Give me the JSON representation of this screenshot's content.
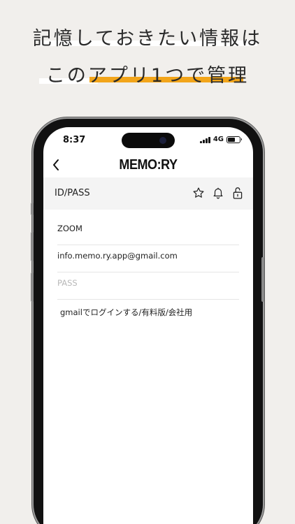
{
  "headline": {
    "line1": "記憶しておきたい情報は",
    "line2": "このアプリ1つで管理",
    "accent_color": "#f2a51a"
  },
  "status_bar": {
    "time": "8:37",
    "network": "4G"
  },
  "nav": {
    "back_icon": "chevron-left-icon",
    "logo": "MEMO:RY"
  },
  "toolbar": {
    "title": "ID/PASS",
    "icons": [
      "star-icon",
      "bell-icon",
      "unlock-icon"
    ]
  },
  "form": {
    "service": "ZOOM",
    "id": "info.memo.ry.app@gmail.com",
    "password_placeholder": "PASS",
    "memo": "gmailでログインする/有料版/会社用"
  }
}
